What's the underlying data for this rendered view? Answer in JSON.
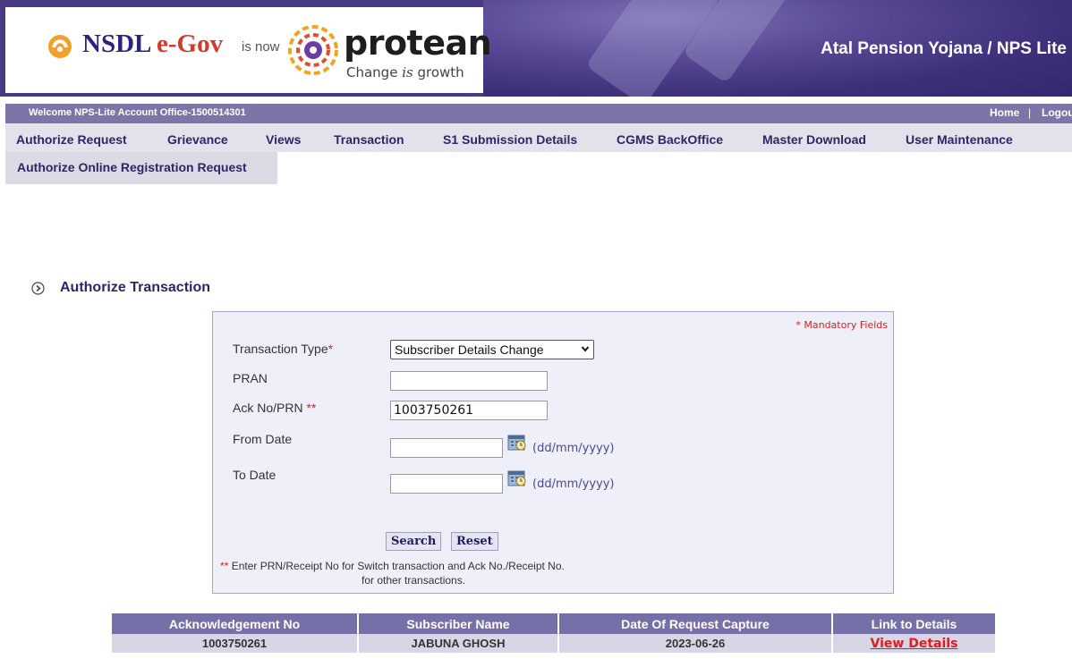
{
  "header": {
    "nsdl_text": "NSDL",
    "nsdl_egov": "e-Gov",
    "is_now": "is now",
    "protean_text": "protean",
    "protean_tag_pre": "Change ",
    "protean_tag_is": "is",
    "protean_tag_post": " growth",
    "app_title": "Atal Pension Yojana / NPS Lite"
  },
  "welcome_bar": {
    "text": "Welcome NPS-Lite Account Office-1500514301",
    "home": "Home",
    "separator": "|",
    "logout": "Logout"
  },
  "menu": {
    "items": [
      "Authorize Request",
      "Grievance",
      "Views",
      "Transaction",
      "S1 Submission Details",
      "CGMS BackOffice",
      "Master Download",
      "User Maintenance"
    ],
    "submenu": "Authorize Online Registration Request"
  },
  "section_title": "Authorize Transaction",
  "form": {
    "mandatory_note": "* Mandatory Fields",
    "transaction_type_label": "Transaction Type",
    "transaction_type_value": "Subscriber Details Change",
    "pran_label": "PRAN",
    "pran_value": "",
    "ack_label": "Ack No/PRN",
    "ack_stars": "**",
    "ack_value": "1003750261",
    "from_date_label": "From Date",
    "from_date_value": "",
    "to_date_label": "To Date",
    "to_date_value": "",
    "date_format_hint": "(dd/mm/yyyy)",
    "search_button": "Search",
    "reset_button": "Reset",
    "note_line1": "Enter PRN/Receipt No for Switch transaction and Ack No./Receipt No.",
    "note_line2": "for other transactions."
  },
  "results": {
    "headers": [
      "Acknowledgement No",
      "Subscriber Name",
      "Date Of Request Capture",
      "Link to Details"
    ],
    "rows": [
      {
        "ack_no": "1003750261",
        "subscriber_name": "JABUNA GHOSH",
        "date": "2023-06-26",
        "link": "View Details"
      }
    ]
  },
  "colors": {
    "brand_purple": "#4a3a84",
    "menu_text": "#2b2768",
    "required_red": "#d42020",
    "link_red": "#e01b1b"
  }
}
